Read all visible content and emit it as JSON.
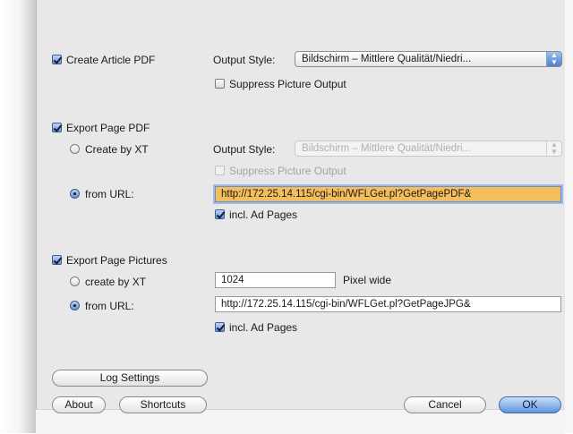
{
  "create_article_pdf": {
    "label": "Create Article PDF",
    "checked": true,
    "output_style_label": "Output Style:",
    "output_style_value": "Bildschirm – Mittlere Qualität/Niedri...",
    "suppress_label": "Suppress Picture Output",
    "suppress_checked": false
  },
  "export_page_pdf": {
    "label": "Export Page PDF",
    "checked": true,
    "create_by_xt_label": "Create by XT",
    "output_style_label": "Output Style:",
    "output_style_value": "Bildschirm – Mittlere Qualität/Niedri...",
    "suppress_label": "Suppress Picture Output",
    "from_url_label": "from URL:",
    "url_value": "http://172.25.14.115/cgi-bin/WFLGet.pl?GetPagePDF&",
    "incl_ad_label": "incl. Ad Pages",
    "incl_ad_checked": true
  },
  "export_page_pictures": {
    "label": "Export Page Pictures",
    "checked": true,
    "create_by_xt_label": "create by XT",
    "pixel_value": "1024",
    "pixel_unit_label": "Pixel wide",
    "from_url_label": "from URL:",
    "url_value": "http://172.25.14.115/cgi-bin/WFLGet.pl?GetPageJPG&",
    "incl_ad_label": "incl. Ad Pages",
    "incl_ad_checked": true
  },
  "buttons": {
    "log_settings": "Log Settings",
    "about": "About",
    "shortcuts": "Shortcuts",
    "cancel": "Cancel",
    "ok": "OK"
  }
}
